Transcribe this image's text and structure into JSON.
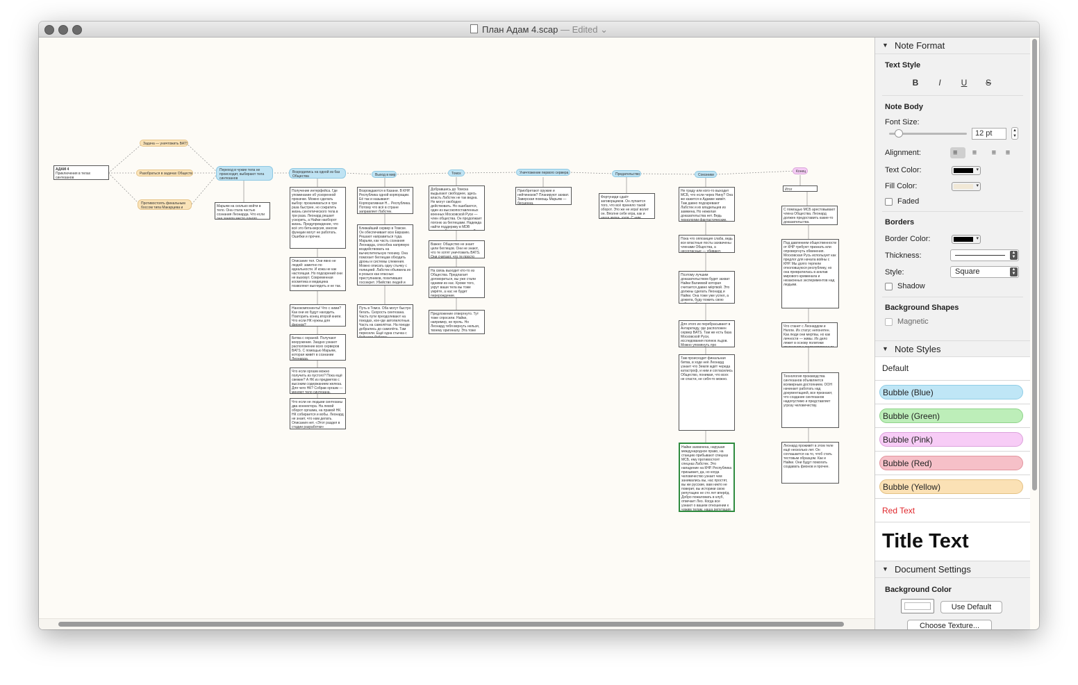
{
  "window": {
    "title": "План Адам 4.scap",
    "status": "— Edited",
    "chevron": "⌄"
  },
  "canvas": {
    "root": {
      "title": "АДАМ 4",
      "body": "Приключения в телах синтезанов"
    },
    "side_bubbles": [
      "Задача — уничтожить BATS",
      "Разобраться в задачах Общества",
      "Противостоять финальным боссом типа Макарцева и Нелли"
    ],
    "main_bubbles": [
      "Переход в чужие тела не происходит, выбирают тела синтезанов",
      "Возродились на одной из баз Общества",
      "Выход в мир",
      "Томск",
      "Уничтожение первого сервера",
      "Предательство",
      "Союзники",
      "Конец"
    ],
    "notes": [
      "Марьям на сколько войти в тело. Она стала частью сознания Леонарда. Что если она заняла место одного фиона?",
      "Получение интерфейса. Где упоминание об ускоренной прокачке. Можно сделать выбор: прокачиваться в три раза быстрее, но сократить жизнь синтетического тела в три раза. Леонард решает ускорить, а Найки наоборот жизнь. Предупреждение, что всё это бета-версия, многие функции могут не работать. Ошибки и прочее.",
      "Описание тел. Они явно не людей: заметно по идеальности. И кожа не как настоящая. Но подозрений они не вызовут. Современная косметика и медицина позволяют выглядеть и не так.",
      "Нанокомпоненты! Что с ними? Как они их будут находить. Повторить конец второй книги. Что если НК нужны для фионов?",
      "Битва с охраной. Получают вооружение. Заодно узнают расположение всех серверов BATS. С помощью Марьям, которая живёт в сознании Леонарда.",
      "Что если оргазм можно получить из пустого? Пока ещё свежие? А НК из предметов с высоким содержанием железа. Для чего НК? Собрав оргазм — меняют тело синтезана.",
      "Что если не людьми синтезаны два коннектора. На левой оборот оргазма, на правой НК. НК собирается и вобы. Леонард не знает, что нам делать. Описания нет. «Этот раздел в стадии разработки»",
      "Возрождаются в Казани. В КНР. Республика одной корпорации. Её так и называют: Корпоративная Н... Республика. Потому что всё в стране заправляет Лабстек.",
      "Ближайший сервер в Томске. Он обеспечивает всю Евразию. Решают направиться туда. Марьям, как часть сознания Леонарда, способна напрямую воздействовать на вычислительную технику. Она помогает беглецам обходить дроны и системы слежения. Можно описать одну стычку с полицией. Лабстек объявила их в розыск как опасных преступников, похитивших госсекрет. Убийство людей и моральные терзания.",
      "Путь в Томск. Оба могут быстро бегать. Скорость синтезана. Часть пути преодолевают на поездах, кое-где автопилотные. Часть на самолётах. На поезде добрались до самолёта. Там пересели. Ещё одна стычка с бойцами Лабстек.",
      "Добравшись до Томска выдыхают свободнее, здесь власть Лабстек не так видна. Не могут свободно действовать. Но ошибаются, один из высокопоставленных военных Московской Руси — член общества. Он продолжает погоню за беглецами. Надежда найти поддержку в MDB запуска. Кто знает, кто про?",
      "Важно: Общество не знает цели беглецов. Они не знают, что те хотят уничтожить BATS. Они считают, что те просто сбежали.",
      "На связь выходит кто-то из Общества. Предлагает договориться, вы уже стали одними из нас. Кроме того, укрут ваши тела вы тоже умрёте, а нас не будет перерождение.",
      "Предложение отвергнуто. Тут тоже спросили. Найки, например, не прочь. Но Леонард тебя вернуть нельзя, твоему оригиналу. Эта тоже уничтожит нас, как только мы сдадимся.",
      "Приобретают оружие и нейтинизов? Планируют захват. Заверская помощь Марьям — бесценна.",
      "Фортуниди сдаёт заговорщиков. Он лупается того, что всё приняло такой оборот. Это же не игра! волит он. Вполне себе игра, как и наша жизнь, куля. С ним подставляет и брата.",
      "Не траду или кого-то выходит МСБ, что если через Нину? Она же кажется в Адамке живёт. Там давно подозревают Лабстек и их владельцев из заммена, Но нежелая доказательства нет. Ведь технологии фантастические.",
      "Пока что оппозиция слаба, ведь все властные посты захвачены членами Общества, а несогласные — убивают.",
      "Поэтому лучшим доказательством будет захват Найки Валиевой которая считается давно мёртвой. Это должны сделать Леонард и Найки. Она тоже уже успел, а дожила, буду пожить свою себя, чтобы неказать.",
      "Для этого их перебрасывают в Антарктиду, где расположен сервер BATS. Там же есть база Московской Руси, исследования полнюк льдов. Можно упомянуть про катаклизмы.",
      "Там происходит финальная битва, в ходе неё Леонард узнает что Земля ждёт череда катастроф, и ним и согласились Общество, понимая, что всех не спасти, не себя-то можно.",
      "Найки захвачена, нарушая международное право, на станцию прибывают спецназ МСБ, ему противостоят спецназ Лабстек. Это нападение на КНР. Республика призывает, да, но когда человечество узнает чем занимались вы, нас простят, вы же русские, вам никто не поверит, вы историки свою репутацию не сто лет вперёд. Добро пожаловать в клуб, отвечает Лео. Когда все узнают о вашем отношении к чужим телам, наша репутация будет читайшим хрусталём в сравнении с вашей.",
      "Итог приключений?",
      "С помощью МСБ арестовывают члена Общества. Леонард должен предоставить какие-то доказательства.",
      "Под давлением общественности от КНР требуют признать или опровергнуть обвинения. Московская Русь использует как предлог для начала войны с КНР. Мы долго терпели отколовшуюся республику, но она превратилась в анклав мирового криминала и незаконных экспериментов над людьми.",
      "Что станет с Леонардом и Нелли. Их статус непонятен. Как люди они мертвы, но как личности — живы. Их дело ляжет в основу политики отношения к синтезированным личностям.",
      "Технология производства синтезанов объявляется всемирным достоянием. ООН начинает работать над документацией, все признают, что создание синтезанов надопустимо и представляет угрозу человечеству.",
      "Леонард проживёт в этом теле ещё несколько лет. Он соглашается на то, чтоб стать тестовым образцом. Как и Найки. Они будут помогать создавать фионов и прочее."
    ]
  },
  "inspector": {
    "note_format": {
      "header": "Note Format",
      "text_style_label": "Text Style",
      "bold": "B",
      "italic": "I",
      "underline": "U",
      "strike": "S",
      "note_body_label": "Note Body",
      "font_size_label": "Font Size:",
      "font_size_value": "12 pt",
      "font_size_fraction": 0.08,
      "alignment_label": "Alignment:",
      "align_left": "≡",
      "align_center": "≡",
      "align_right": "≡",
      "align_justify": "≡",
      "text_color_label": "Text Color:",
      "text_color": "#000000",
      "fill_color_label": "Fill Color:",
      "fill_color": "#f1e8d6",
      "faded_label": "Faded"
    },
    "borders": {
      "header": "Borders",
      "border_color_label": "Border Color:",
      "border_color": "#000000",
      "thickness_label": "Thickness:",
      "style_label": "Style:",
      "style_value": "Square",
      "shadow_label": "Shadow"
    },
    "background_shapes": {
      "header": "Background Shapes",
      "magnetic_label": "Magnetic"
    },
    "note_styles": {
      "header": "Note Styles",
      "default_label": "Default",
      "bubble_blue": "Bubble (Blue)",
      "bubble_green": "Bubble (Green)",
      "bubble_pink": "Bubble (Pink)",
      "bubble_red": "Bubble (Red)",
      "bubble_yellow": "Bubble (Yellow)",
      "red_text": "Red Text",
      "title_text": "Title Text",
      "colors": {
        "blue": "#bfe6f6",
        "green": "#bdeeb9",
        "pink": "#f7ccf6",
        "red": "#f6c0c8",
        "yellow": "#fbe1b5",
        "red_text": "#e0262b"
      }
    },
    "document_settings": {
      "header": "Document Settings",
      "background_color_label": "Background Color",
      "use_default": "Use Default",
      "choose_texture": "Choose Texture..."
    }
  }
}
